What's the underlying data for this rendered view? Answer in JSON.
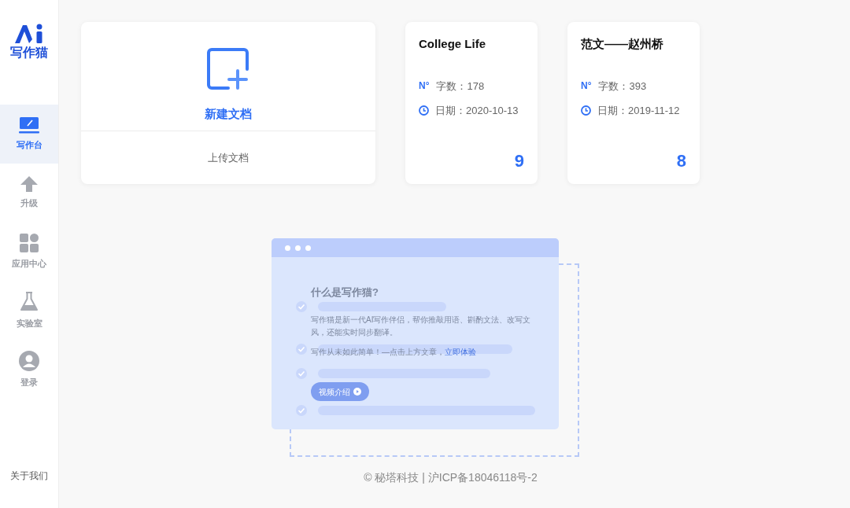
{
  "sidebar": {
    "logo_text": "写作猫",
    "items": [
      {
        "label": "写作台",
        "kind": "laptop",
        "selected": true
      },
      {
        "label": "升级",
        "kind": "arrow",
        "selected": false
      },
      {
        "label": "应用中心",
        "kind": "apps",
        "selected": false
      },
      {
        "label": "实验室",
        "kind": "flask",
        "selected": false
      },
      {
        "label": "登录",
        "kind": "user",
        "selected": false
      }
    ],
    "about": "关于我们"
  },
  "new_card": {
    "new_label": "新建文档",
    "upload_label": "上传文档"
  },
  "documents": [
    {
      "title": "College Life",
      "number_sign": "N°",
      "word_count": "字数：178",
      "date": "日期：2020-10-13",
      "score": "9"
    },
    {
      "title": "范文——赵州桥",
      "number_sign": "N°",
      "word_count": "字数：393",
      "date": "日期：2019-11-12",
      "score": "8"
    }
  ],
  "intro": {
    "heading": "什么是写作猫?",
    "paragraph": "写作猫是新一代AI写作伴侣，帮你推敲用语、斟酌文法、改写文风，还能实时同步翻译。",
    "cta_text": "写作从未如此简单！—点击上方文章，",
    "cta_link": "立即体验",
    "video_button": "视频介绍"
  },
  "footer": "© 秘塔科技 | 沪ICP备18046118号-2"
}
